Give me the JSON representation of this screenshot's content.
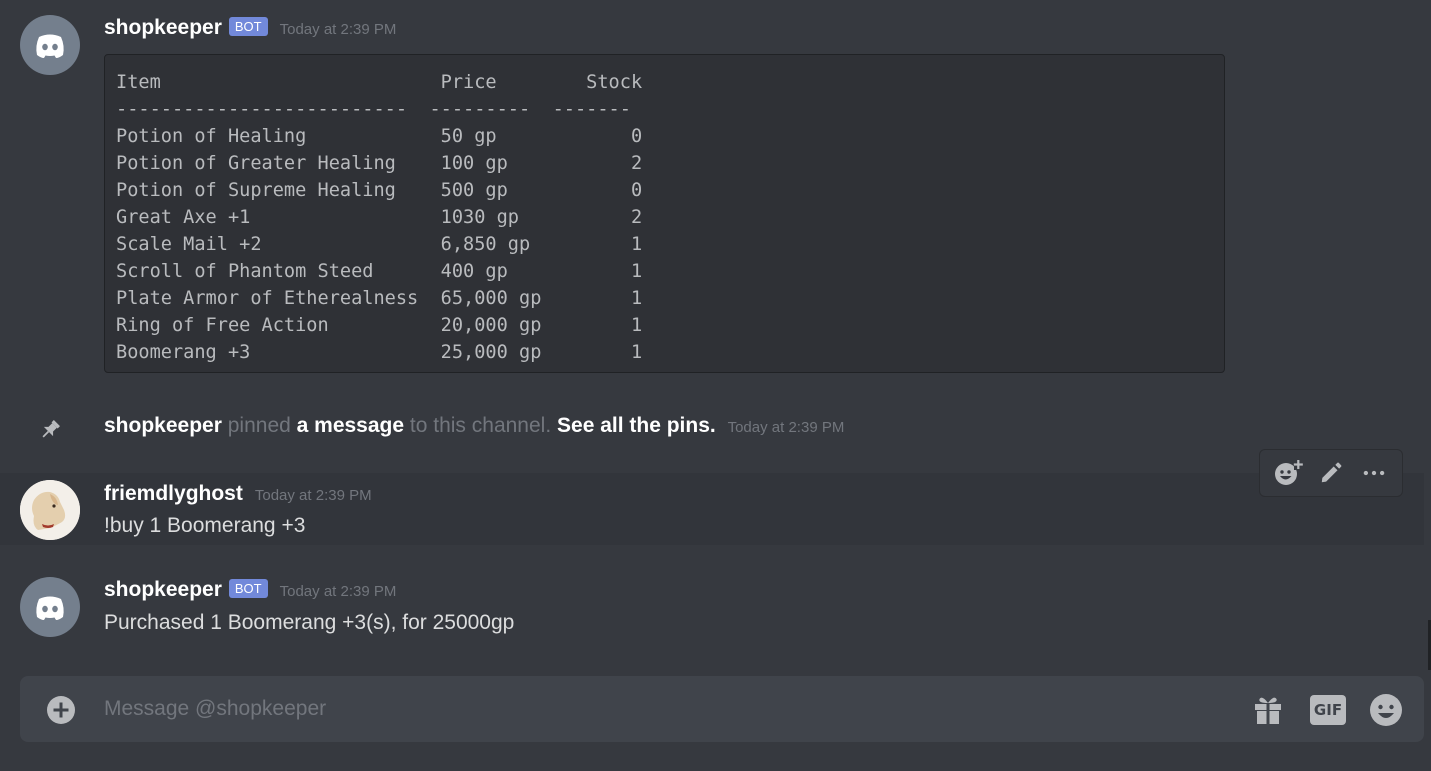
{
  "messages": [
    {
      "author": "shopkeeper",
      "bot_tag": "BOT",
      "timestamp": "Today at 2:39 PM",
      "code_lines": [
        "Item                         Price        Stock",
        "--------------------------  ---------  -------",
        "Potion of Healing            50 gp            0",
        "Potion of Greater Healing    100 gp           2",
        "Potion of Supreme Healing    500 gp           0",
        "Great Axe +1                 1030 gp          2",
        "Scale Mail +2                6,850 gp         1",
        "Scroll of Phantom Steed      400 gp           1",
        "Plate Armor of Etherealness  65,000 gp        1",
        "Ring of Free Action          20,000 gp        1",
        "Boomerang +3                 25,000 gp        1"
      ]
    },
    {
      "author": "friemdlyghost",
      "timestamp": "Today at 2:39 PM",
      "text": "!buy 1 Boomerang +3"
    },
    {
      "author": "shopkeeper",
      "bot_tag": "BOT",
      "timestamp": "Today at 2:39 PM",
      "text": "Purchased 1 Boomerang +3(s), for 25000gp"
    }
  ],
  "system_message": {
    "actor": "shopkeeper",
    "pinned_word": "pinned",
    "link_text": "a message",
    "suffix": "to this channel.",
    "see_pins": "See all the pins.",
    "timestamp": "Today at 2:39 PM"
  },
  "toolbar": {
    "actions": [
      "add-reaction-icon",
      "edit-icon",
      "more-options-icon"
    ]
  },
  "composer": {
    "placeholder": "Message @shopkeeper",
    "value": "",
    "gif_label": "GIF",
    "icons": [
      "plus-circle-icon",
      "gift-icon",
      "gif-icon",
      "emoji-icon"
    ]
  },
  "colors": {
    "background": "#36393f",
    "codeblock": "#2f3136",
    "bot_tag": "#7289da",
    "composer": "#40444b",
    "muted_text": "#72767d"
  }
}
